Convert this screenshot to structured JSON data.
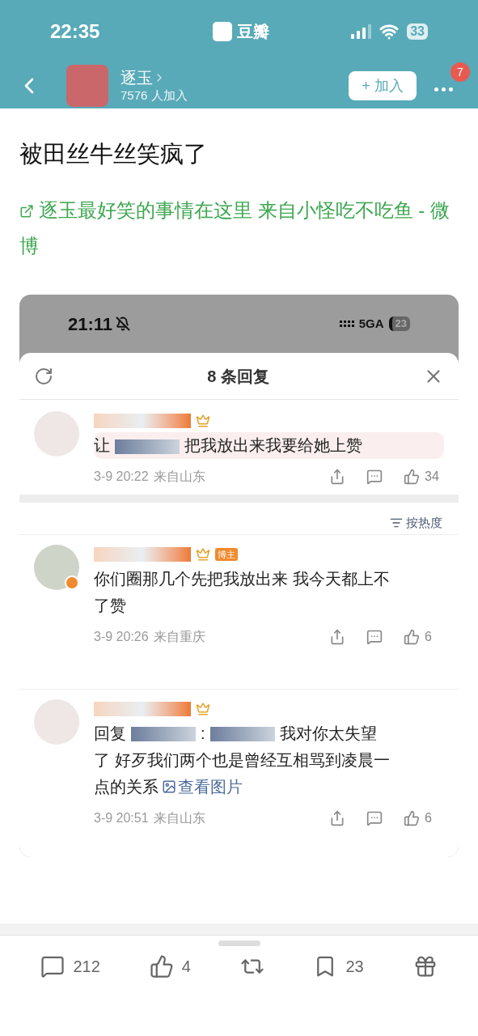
{
  "status_bar": {
    "time": "22:35",
    "app_name": "豆瓣",
    "battery": "33"
  },
  "group": {
    "name": "逐玉",
    "members": "7576 人加入",
    "join_button": "+ 加入",
    "notification_count": "7"
  },
  "post": {
    "title": "被田丝牛丝笑疯了",
    "link": "逐玉最好笑的事情在这里  来自小怪吃不吃鱼 - 微博"
  },
  "embedded_screenshot": {
    "status_bar": {
      "time": "21:11",
      "network": "5GA",
      "battery": "23"
    },
    "sheet_title": "8 条回复",
    "sort_label": "按热度",
    "comments": [
      {
        "verified": false,
        "parts": [
          {
            "kind": "text",
            "text": "让"
          },
          {
            "kind": "redaction"
          },
          {
            "kind": "text",
            "text": "把我放出来我要给她上赞"
          }
        ],
        "time": "3-9 20:22",
        "location": "来自山东",
        "likes": "34"
      },
      {
        "verified": true,
        "badge": "博主",
        "parts": [
          {
            "kind": "text",
            "text": "你们圈那几个先把我放出来 我今天都上不"
          },
          {
            "kind": "break"
          },
          {
            "kind": "text",
            "text": "了赞"
          }
        ],
        "time": "3-9 20:26",
        "location": "来自重庆",
        "likes": "6"
      },
      {
        "verified": false,
        "parts": [
          {
            "kind": "text",
            "text": "回复"
          },
          {
            "kind": "redaction"
          },
          {
            "kind": "text",
            "text": ":"
          },
          {
            "kind": "redaction"
          },
          {
            "kind": "text",
            "text": "我对你太失望"
          },
          {
            "kind": "break"
          },
          {
            "kind": "text",
            "text": "了 好歹我们两个也是曾经互相骂到凌晨一"
          },
          {
            "kind": "break"
          },
          {
            "kind": "text",
            "text": "点的关系"
          }
        ],
        "view_image": "查看图片",
        "time": "3-9 20:51",
        "location": "来自山东",
        "likes": "6"
      }
    ]
  },
  "action_bar": [
    {
      "kind": "comment",
      "count": "212"
    },
    {
      "kind": "like",
      "count": "4"
    },
    {
      "kind": "repost"
    },
    {
      "kind": "bookmark",
      "count": "23"
    },
    {
      "kind": "gift"
    }
  ]
}
